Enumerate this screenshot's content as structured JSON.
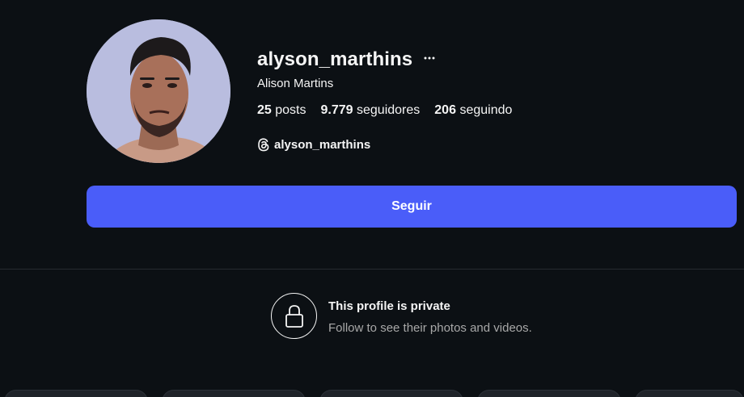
{
  "profile": {
    "username": "alyson_marthins",
    "full_name": "Alison Martins",
    "options_icon": "more-horizontal-icon",
    "stats": {
      "posts_count": "25",
      "posts_label": "posts",
      "followers_count": "9.779",
      "followers_label": "seguidores",
      "following_count": "206",
      "following_label": "seguindo"
    },
    "threads_handle": "alyson_marthins",
    "threads_icon": "threads-icon"
  },
  "actions": {
    "follow_label": "Seguir",
    "follow_color": "#4a5df9"
  },
  "private_notice": {
    "icon": "lock-icon",
    "title": "This profile is private",
    "subtitle": "Follow to see their photos and videos."
  },
  "colors": {
    "background": "#0c1014",
    "text_primary": "#f5f5f5",
    "text_secondary": "#a8a8a8"
  }
}
